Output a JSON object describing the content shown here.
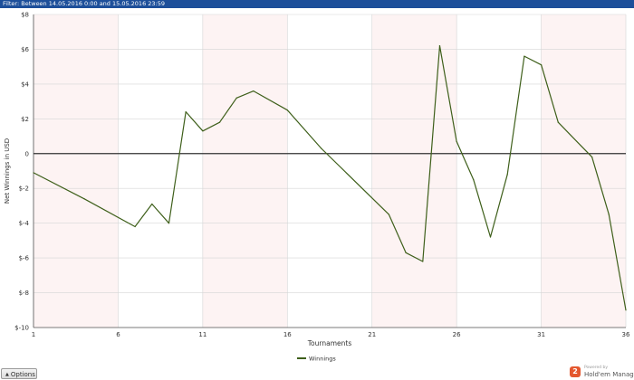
{
  "filter": {
    "text": "Filter: Between 14.05.2016 0:00 and 15.05.2016 23:59"
  },
  "options": {
    "label": "Options",
    "arrow": "▲"
  },
  "branding": {
    "powered_by": "Powered by",
    "name": "Hold'em Manager",
    "badge": "2"
  },
  "colors": {
    "series": "#3e5f1a",
    "zero_line": "#333333",
    "band": "#fdf3f3",
    "grid": "#d6d6d6",
    "header": "#1d4f9a"
  },
  "chart_data": {
    "type": "line",
    "xlabel": "Tournaments",
    "ylabel": "Net Winnings in USD",
    "xlim": [
      1,
      36
    ],
    "ylim": [
      -10,
      8
    ],
    "x_ticks": [
      1,
      6,
      11,
      16,
      21,
      26,
      31,
      36
    ],
    "y_ticks": [
      8,
      6,
      4,
      2,
      0,
      -2,
      -4,
      -6,
      -8,
      -10
    ],
    "y_tick_labels": [
      "$8",
      "$6",
      "$4",
      "$2",
      "0",
      "$-2",
      "$-4",
      "$-6",
      "$-8",
      "$-10"
    ],
    "shaded_bands": [
      [
        1,
        6
      ],
      [
        11,
        16
      ],
      [
        21,
        26
      ],
      [
        31,
        36
      ]
    ],
    "zero_line": true,
    "legend_position": "bottom",
    "series": [
      {
        "name": "Winnings",
        "x": [
          1,
          4,
          7,
          8,
          9,
          10,
          11,
          12,
          13,
          14,
          16,
          18,
          22,
          23,
          24,
          25,
          26,
          27,
          28,
          29,
          30,
          31,
          32,
          34,
          35,
          36
        ],
        "values": [
          -1.1,
          -2.6,
          -4.2,
          -2.9,
          -4.0,
          2.4,
          1.3,
          1.8,
          3.2,
          3.6,
          2.5,
          0.3,
          -3.5,
          -5.7,
          -6.2,
          6.2,
          0.7,
          -1.5,
          -4.8,
          -1.2,
          5.6,
          5.1,
          1.8,
          -0.2,
          -3.5,
          -9.0
        ]
      }
    ]
  }
}
